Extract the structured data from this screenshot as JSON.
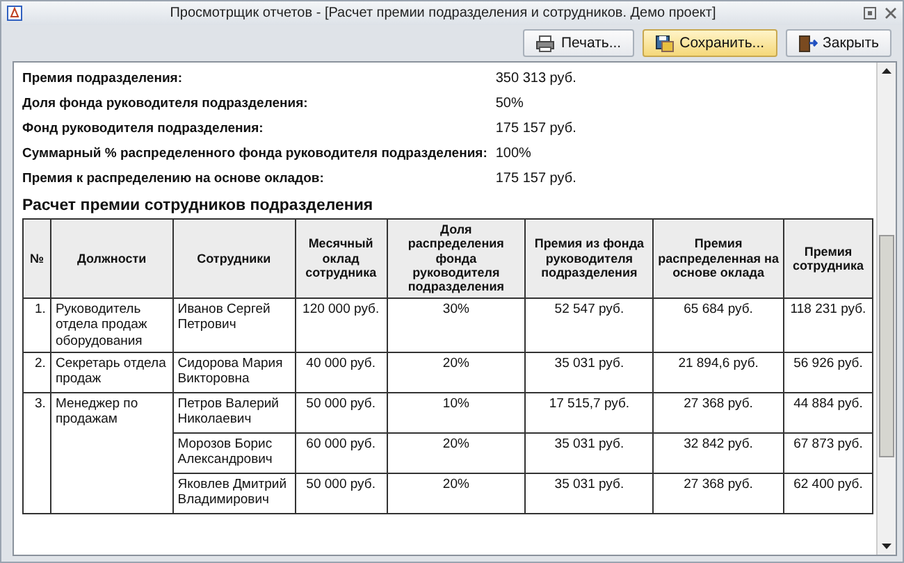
{
  "window": {
    "title": "Просмотрщик отчетов -  [Расчет премии подразделения и сотрудников. Демо проект]"
  },
  "toolbar": [
    {
      "label": "Печать...",
      "selected": false
    },
    {
      "label": "Сохранить...",
      "selected": true
    },
    {
      "label": "Закрыть",
      "selected": false
    }
  ],
  "summary": [
    {
      "label": "Премия подразделения:",
      "value": "350 313 руб."
    },
    {
      "label": "Доля фонда руководителя подразделения:",
      "value": "50%"
    },
    {
      "label": "Фонд руководителя подразделения:",
      "value": "175 157 руб."
    },
    {
      "label": "Суммарный % распределенного фонда руководителя подразделения:",
      "value": "100%"
    },
    {
      "label": "Премия к распределению на основе окладов:",
      "value": "175 157 руб."
    }
  ],
  "table": {
    "title": "Расчет премии сотрудников подразделения",
    "columns": [
      "№",
      "Должности",
      "Сотрудники",
      "Месячный оклад сотрудника",
      "Доля распределения фонда руководителя подразделения",
      "Премия из фонда руководителя подразделения",
      "Премия распределенная на основе оклада",
      "Премия сотрудника"
    ],
    "groups": [
      {
        "num": "1.",
        "position": "Руководитель отдела продаж оборудования",
        "rows": [
          {
            "employee": "Иванов Сергей Петрович",
            "salary": "120 000 руб.",
            "share": "30%",
            "fund_bonus": "52 547 руб.",
            "salary_bonus": "65 684 руб.",
            "total": "118 231 руб."
          }
        ]
      },
      {
        "num": "2.",
        "position": "Секретарь отдела продаж",
        "rows": [
          {
            "employee": "Сидорова Мария Викторовна",
            "salary": "40 000 руб.",
            "share": "20%",
            "fund_bonus": "35 031 руб.",
            "salary_bonus": "21 894,6 руб.",
            "total": "56 926 руб."
          }
        ]
      },
      {
        "num": "3.",
        "position": "Менеджер по продажам",
        "rows": [
          {
            "employee": "Петров Валерий Николаевич",
            "salary": "50 000 руб.",
            "share": "10%",
            "fund_bonus": "17 515,7 руб.",
            "salary_bonus": "27 368 руб.",
            "total": "44 884 руб."
          },
          {
            "employee": "Морозов Борис Александрович",
            "salary": "60 000 руб.",
            "share": "20%",
            "fund_bonus": "35 031 руб.",
            "salary_bonus": "32 842 руб.",
            "total": "67 873 руб."
          },
          {
            "employee": "Яковлев Дмитрий Владимирович",
            "salary": "50 000 руб.",
            "share": "20%",
            "fund_bonus": "35 031 руб.",
            "salary_bonus": "27 368 руб.",
            "total": "62 400 руб."
          }
        ]
      }
    ]
  }
}
